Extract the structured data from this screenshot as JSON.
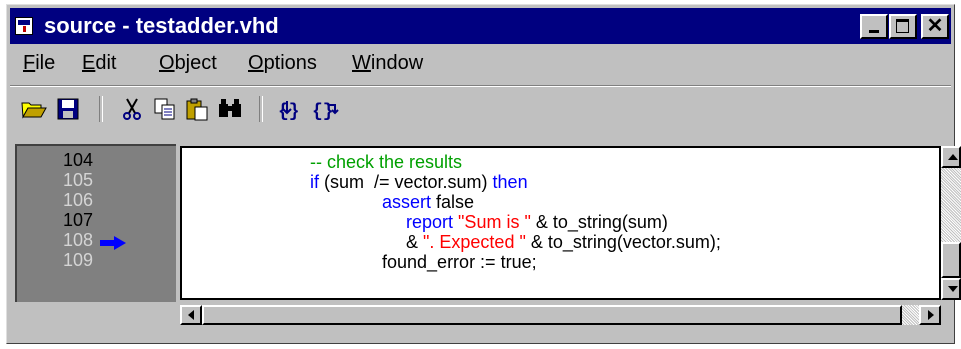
{
  "window": {
    "title": "source - testadder.vhd",
    "colors": {
      "titlebar": "#000080",
      "chrome": "#c0c0c0",
      "gutter": "#808080"
    }
  },
  "menu": [
    "File",
    "Edit",
    "Object",
    "Options",
    "Window"
  ],
  "toolbar": {
    "icons": [
      "open-folder-icon",
      "save-disk-icon",
      "cut-scissors-icon",
      "copy-icon",
      "paste-clipboard-icon",
      "find-binoculars-icon",
      "step-into-icon",
      "step-over-icon"
    ]
  },
  "gutter": {
    "lines": [
      {
        "number": "104",
        "enabled": true
      },
      {
        "number": "105",
        "enabled": false
      },
      {
        "number": "106",
        "enabled": false
      },
      {
        "number": "107",
        "enabled": true
      },
      {
        "number": "108",
        "enabled": false,
        "current": true
      },
      {
        "number": "109",
        "enabled": false
      }
    ],
    "current_line_icon": "arrow-right-icon"
  },
  "code": {
    "colors": {
      "keyword": "#0000ff",
      "string": "#ff0000",
      "comment": "#00a000"
    },
    "l104": {
      "comment": "-- check the results"
    },
    "l105": {
      "kw_if": "if",
      "mid": " (sum  /= vector.sum) ",
      "kw_then": "then"
    },
    "l106": {
      "kw_assert": "assert",
      "rest": " false"
    },
    "l107": {
      "kw_report": "report",
      "str": "\"Sum is \"",
      "rest": " & to_string(sum)"
    },
    "l108": {
      "prefix": "& ",
      "str": "\". Expected \"",
      "rest": " & to_string(vector.sum);"
    },
    "l109": {
      "text": "found_error := true;"
    }
  }
}
